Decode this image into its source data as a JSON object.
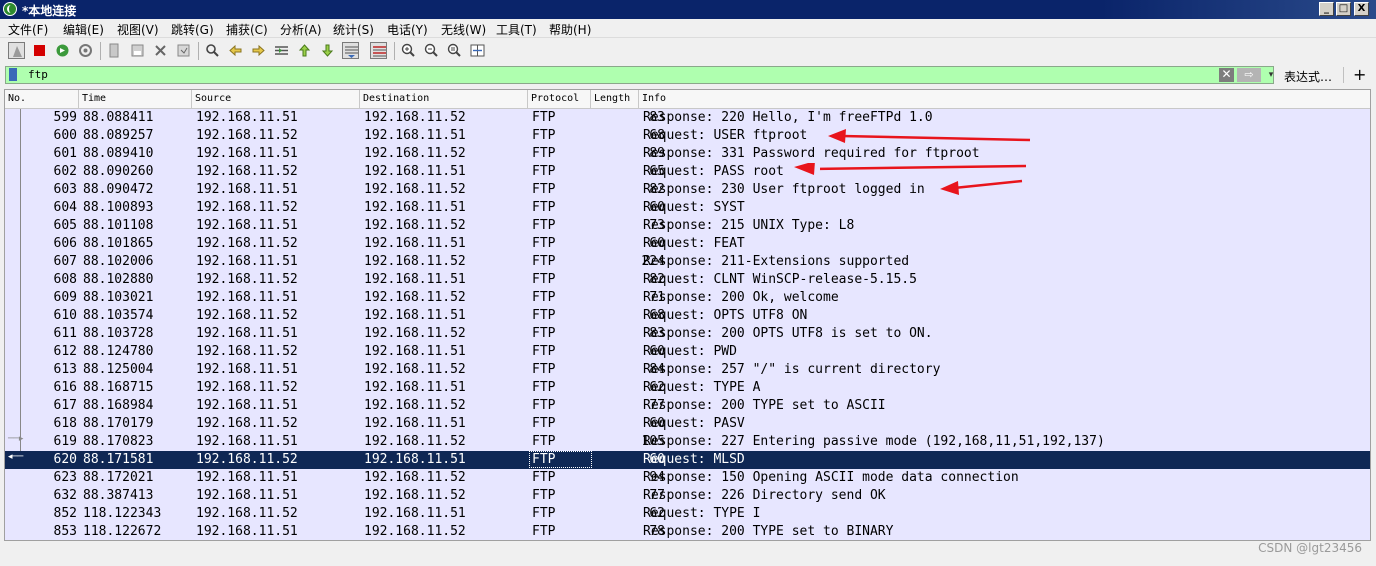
{
  "window": {
    "title": "*本地连接",
    "min_label": "_",
    "max_label": "□",
    "close_label": "X"
  },
  "menu": [
    "文件(F)",
    "编辑(E)",
    "视图(V)",
    "跳转(G)",
    "捕获(C)",
    "分析(A)",
    "统计(S)",
    "电话(Y)",
    "无线(W)",
    "工具(T)",
    "帮助(H)"
  ],
  "filter": {
    "value": "ftp",
    "expression_label": "表达式…",
    "plus_label": "+",
    "clear_label": "✕",
    "apply_label": "⇨",
    "dropdown_label": "▾"
  },
  "columns": [
    "No.",
    "Time",
    "Source",
    "Destination",
    "Protocol",
    "Length",
    "Info"
  ],
  "packets": [
    {
      "no": "599",
      "time": "88.088411",
      "src": "192.168.11.51",
      "dst": "192.168.11.52",
      "proto": "FTP",
      "len": "83",
      "info": "Response: 220 Hello, I'm freeFTPd 1.0"
    },
    {
      "no": "600",
      "time": "88.089257",
      "src": "192.168.11.52",
      "dst": "192.168.11.51",
      "proto": "FTP",
      "len": "68",
      "info": "Request: USER ftproot"
    },
    {
      "no": "601",
      "time": "88.089410",
      "src": "192.168.11.51",
      "dst": "192.168.11.52",
      "proto": "FTP",
      "len": "89",
      "info": "Response: 331 Password required for ftproot"
    },
    {
      "no": "602",
      "time": "88.090260",
      "src": "192.168.11.52",
      "dst": "192.168.11.51",
      "proto": "FTP",
      "len": "65",
      "info": "Request: PASS root"
    },
    {
      "no": "603",
      "time": "88.090472",
      "src": "192.168.11.51",
      "dst": "192.168.11.52",
      "proto": "FTP",
      "len": "82",
      "info": "Response: 230 User ftproot logged in"
    },
    {
      "no": "604",
      "time": "88.100893",
      "src": "192.168.11.52",
      "dst": "192.168.11.51",
      "proto": "FTP",
      "len": "60",
      "info": "Request: SYST"
    },
    {
      "no": "605",
      "time": "88.101108",
      "src": "192.168.11.51",
      "dst": "192.168.11.52",
      "proto": "FTP",
      "len": "73",
      "info": "Response: 215 UNIX Type: L8"
    },
    {
      "no": "606",
      "time": "88.101865",
      "src": "192.168.11.52",
      "dst": "192.168.11.51",
      "proto": "FTP",
      "len": "60",
      "info": "Request: FEAT"
    },
    {
      "no": "607",
      "time": "88.102006",
      "src": "192.168.11.51",
      "dst": "192.168.11.52",
      "proto": "FTP",
      "len": "224",
      "info": "Response: 211-Extensions supported"
    },
    {
      "no": "608",
      "time": "88.102880",
      "src": "192.168.11.52",
      "dst": "192.168.11.51",
      "proto": "FTP",
      "len": "82",
      "info": "Request: CLNT WinSCP-release-5.15.5"
    },
    {
      "no": "609",
      "time": "88.103021",
      "src": "192.168.11.51",
      "dst": "192.168.11.52",
      "proto": "FTP",
      "len": "71",
      "info": "Response: 200 Ok, welcome"
    },
    {
      "no": "610",
      "time": "88.103574",
      "src": "192.168.11.52",
      "dst": "192.168.11.51",
      "proto": "FTP",
      "len": "68",
      "info": "Request: OPTS UTF8 ON"
    },
    {
      "no": "611",
      "time": "88.103728",
      "src": "192.168.11.51",
      "dst": "192.168.11.52",
      "proto": "FTP",
      "len": "83",
      "info": "Response: 200 OPTS UTF8 is set to ON."
    },
    {
      "no": "612",
      "time": "88.124780",
      "src": "192.168.11.52",
      "dst": "192.168.11.51",
      "proto": "FTP",
      "len": "60",
      "info": "Request: PWD"
    },
    {
      "no": "613",
      "time": "88.125004",
      "src": "192.168.11.51",
      "dst": "192.168.11.52",
      "proto": "FTP",
      "len": "84",
      "info": "Response: 257 \"/\" is current directory"
    },
    {
      "no": "616",
      "time": "88.168715",
      "src": "192.168.11.52",
      "dst": "192.168.11.51",
      "proto": "FTP",
      "len": "62",
      "info": "Request: TYPE A"
    },
    {
      "no": "617",
      "time": "88.168984",
      "src": "192.168.11.51",
      "dst": "192.168.11.52",
      "proto": "FTP",
      "len": "77",
      "info": "Response: 200 TYPE set to ASCII"
    },
    {
      "no": "618",
      "time": "88.170179",
      "src": "192.168.11.52",
      "dst": "192.168.11.51",
      "proto": "FTP",
      "len": "60",
      "info": "Request: PASV"
    },
    {
      "no": "619",
      "time": "88.170823",
      "src": "192.168.11.51",
      "dst": "192.168.11.52",
      "proto": "FTP",
      "len": "105",
      "info": "Response: 227 Entering passive mode (192,168,11,51,192,137)"
    },
    {
      "no": "620",
      "time": "88.171581",
      "src": "192.168.11.52",
      "dst": "192.168.11.51",
      "proto": "FTP",
      "len": "60",
      "info": "Request: MLSD",
      "selected": true
    },
    {
      "no": "623",
      "time": "88.172021",
      "src": "192.168.11.51",
      "dst": "192.168.11.52",
      "proto": "FTP",
      "len": "94",
      "info": "Response: 150 Opening ASCII mode data connection"
    },
    {
      "no": "632",
      "time": "88.387413",
      "src": "192.168.11.51",
      "dst": "192.168.11.52",
      "proto": "FTP",
      "len": "77",
      "info": "Response: 226 Directory send OK"
    },
    {
      "no": "852",
      "time": "118.122343",
      "src": "192.168.11.52",
      "dst": "192.168.11.51",
      "proto": "FTP",
      "len": "62",
      "info": "Request: TYPE I"
    },
    {
      "no": "853",
      "time": "118.122672",
      "src": "192.168.11.51",
      "dst": "192.168.11.52",
      "proto": "FTP",
      "len": "78",
      "info": "Response: 200 TYPE set to BINARY"
    }
  ],
  "watermark": "CSDN @lgt23456",
  "colors": {
    "row_bg": "#e7e6ff",
    "selected_bg": "#0f2754",
    "filter_bg": "#afffaf",
    "annotation": "#e8141c"
  }
}
